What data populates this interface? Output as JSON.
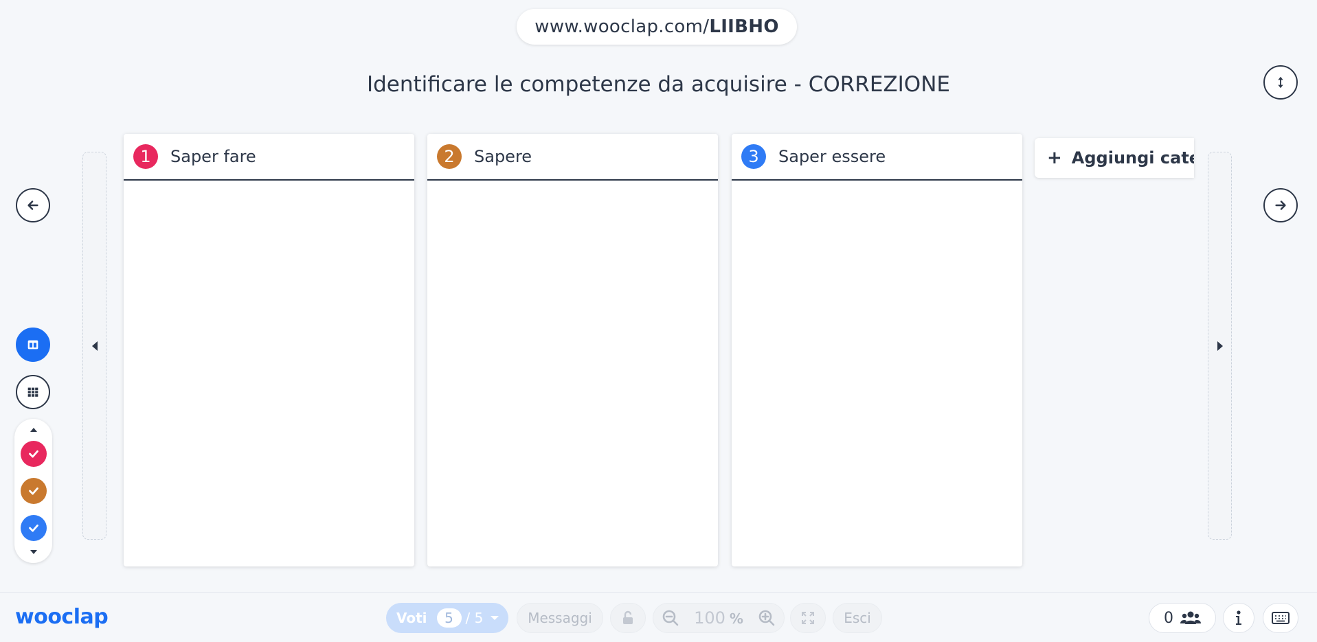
{
  "header": {
    "url_prefix": "www.wooclap.com/",
    "event_code": "LIIBHO",
    "question_title": "Identificare le competenze da acquisire - CORREZIONE"
  },
  "categories": [
    {
      "number": "1",
      "label": "Saper fare",
      "color": "#e8285e"
    },
    {
      "number": "2",
      "label": "Sapere",
      "color": "#c9792e"
    },
    {
      "number": "3",
      "label": "Saper essere",
      "color": "#2f7bf5"
    }
  ],
  "add_category": {
    "label": "Aggiungi categoria"
  },
  "toolbar": {
    "brand": "wooclap",
    "votes_label": "Voti",
    "votes_count": "5",
    "votes_total": "/ 5",
    "messages_label": "Messaggi",
    "zoom_value": "100",
    "zoom_unit": "%",
    "exit_label": "Esci",
    "participants_count": "0"
  },
  "icons": {
    "prev": "arrow-left-icon",
    "next": "arrow-right-icon",
    "height_toggle": "vertical-arrows-icon",
    "columns_view": "columns-icon",
    "grid_view": "grid-icon",
    "lock": "unlock-icon",
    "zoom_out": "zoom-out-icon",
    "zoom_in": "zoom-in-icon",
    "fullscreen": "expand-icon",
    "participants": "users-icon",
    "info": "info-icon",
    "keyboard": "keyboard-icon"
  },
  "colors": {
    "accent": "#1b6ef3",
    "text": "#2d3748",
    "background": "#f5f7fa"
  }
}
